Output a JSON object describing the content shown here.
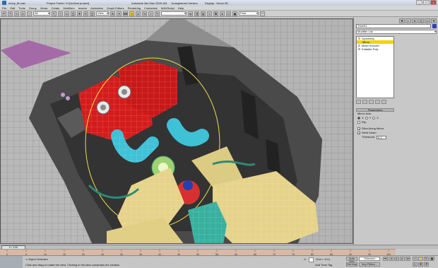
{
  "window": {
    "title": "emny_f8.max",
    "project": "Project Folder: D:\\[ciuDad project]",
    "app": "Autodesk 3ds Max 2009 x64",
    "edition": "Unregistered Version",
    "renderer": "Display : Direct 3D",
    "min": "_",
    "max": "□",
    "close": "×"
  },
  "menu": [
    "File",
    "Edit",
    "Tools",
    "Group",
    "Views",
    "Create",
    "Modifiers",
    "reactor",
    "Animation",
    "Graph Editors",
    "Rendering",
    "Customize",
    "MAXScript",
    "Help"
  ],
  "toolbar": {
    "selection_filter": "All",
    "ref_coord": "View",
    "named_selection": "Print"
  },
  "command_panel": {
    "object_name": "Tube01",
    "object_color": "#3040b0",
    "modifier_list_label": "Modifier List",
    "stack": [
      {
        "label": "Symmetry",
        "selected": false
      },
      {
        "label": "Mirror",
        "selected": true
      },
      {
        "label": "Mesh Smooth",
        "selected": false
      },
      {
        "label": "Editable Poly",
        "selected": false
      }
    ],
    "rollout_title": "Parameters",
    "mirror_axis_label": "Mirror Axis:",
    "axes": [
      "X",
      "Y",
      "Z"
    ],
    "axis_selected": "X",
    "flip_label": "Flip",
    "slice_label": "Slice Along Mirror",
    "weld_label": "Weld Seam",
    "threshold_label": "Threshold:",
    "threshold_value": "0.1"
  },
  "time": {
    "slider_label": "0 / 100",
    "ticks": [
      "0",
      "5",
      "10",
      "15",
      "20",
      "25",
      "30",
      "35",
      "40",
      "45",
      "50",
      "55",
      "60",
      "65",
      "70",
      "75",
      "80",
      "85",
      "90",
      "95",
      "100"
    ]
  },
  "status": {
    "selection": "1 Object Selected",
    "prompt": "Click and drag to rotate the view.  Clicking in the tabs constrains the rotation",
    "x_label": "X:",
    "grid": "Grid = 10,0",
    "add_time_tag": "Add Time Tag",
    "auto_key": "Auto Key",
    "set_key": "Set Key",
    "selected_dd": "Selected",
    "key_filters": "Key Filters..."
  },
  "colors": {
    "engine_red": "#d41c1c",
    "intake_yellow": "#e6d38a",
    "hose_cyan": "#3fc1d6",
    "teal_box": "#38b0a0",
    "wire": "#ffffff",
    "selection_yellow": "#f2d500"
  }
}
